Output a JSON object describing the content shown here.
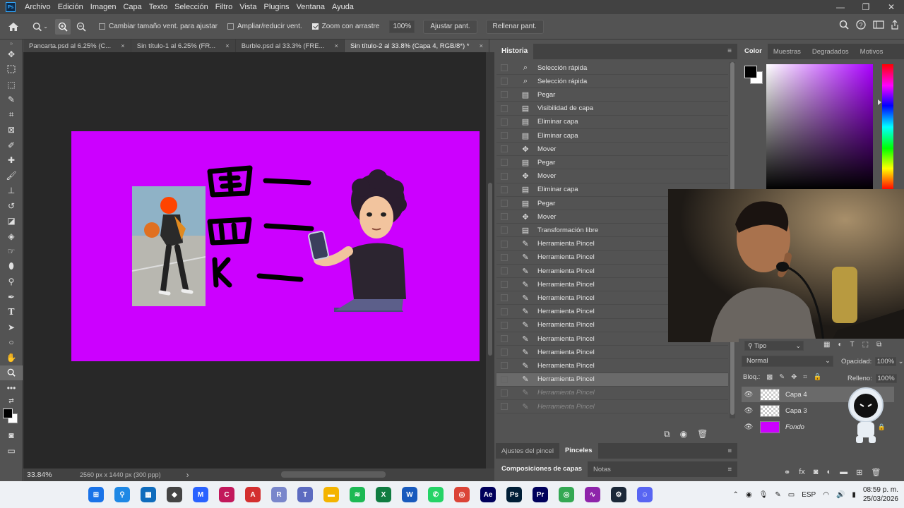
{
  "menu": {
    "app_icon_text": "Ps",
    "items": [
      "Archivo",
      "Edición",
      "Imagen",
      "Capa",
      "Texto",
      "Selección",
      "Filtro",
      "Vista",
      "Plugins",
      "Ventana",
      "Ayuda"
    ],
    "window_controls": [
      "—",
      "❐",
      "✕"
    ]
  },
  "options": {
    "home_icon": "home-icon",
    "zoom_icon": "zoom-icon",
    "resize_windows_label": "Cambiar tamaño vent. para ajustar",
    "resize_windows_checked": false,
    "zoom_all_label": "Ampliar/reducir vent.",
    "zoom_all_checked": false,
    "scrubby_label": "Zoom con arrastre",
    "scrubby_checked": true,
    "zoom_value": "100%",
    "fit_button": "Ajustar pant.",
    "fill_button": "Rellenar pant."
  },
  "doc_tabs": [
    {
      "label": "Pancarta.psd al 6.25% (C...",
      "close": "×",
      "active": false
    },
    {
      "label": "Sin título-1 al 6.25% (FR...",
      "close": "×",
      "active": false
    },
    {
      "label": "Burble.psd al 33.3% (FRE...",
      "close": "×",
      "active": false
    },
    {
      "label": "Sin título-2 al 33.8% (Capa 4, RGB/8*) *",
      "close": "×",
      "active": true
    }
  ],
  "status": {
    "zoom": "33.84%",
    "doc_info": "2560 px x 1440 px (300 ppp)",
    "arrow": "›"
  },
  "history": {
    "title": "Historia",
    "items": [
      {
        "icon": "quick-selection-icon",
        "label": "Selección rápida",
        "state": "normal"
      },
      {
        "icon": "quick-selection-icon",
        "label": "Selección rápida",
        "state": "normal"
      },
      {
        "icon": "document-icon",
        "label": "Pegar",
        "state": "normal"
      },
      {
        "icon": "document-icon",
        "label": "Visibilidad de capa",
        "state": "normal"
      },
      {
        "icon": "document-icon",
        "label": "Eliminar capa",
        "state": "normal"
      },
      {
        "icon": "document-icon",
        "label": "Eliminar capa",
        "state": "normal"
      },
      {
        "icon": "move-icon",
        "label": "Mover",
        "state": "normal"
      },
      {
        "icon": "document-icon",
        "label": "Pegar",
        "state": "normal"
      },
      {
        "icon": "move-icon",
        "label": "Mover",
        "state": "normal"
      },
      {
        "icon": "document-icon",
        "label": "Eliminar capa",
        "state": "normal"
      },
      {
        "icon": "document-icon",
        "label": "Pegar",
        "state": "normal"
      },
      {
        "icon": "move-icon",
        "label": "Mover",
        "state": "normal"
      },
      {
        "icon": "document-icon",
        "label": "Transformación libre",
        "state": "normal"
      },
      {
        "icon": "brush-icon",
        "label": "Herramienta Pincel",
        "state": "normal"
      },
      {
        "icon": "brush-icon",
        "label": "Herramienta Pincel",
        "state": "normal"
      },
      {
        "icon": "brush-icon",
        "label": "Herramienta Pincel",
        "state": "normal"
      },
      {
        "icon": "brush-icon",
        "label": "Herramienta Pincel",
        "state": "normal"
      },
      {
        "icon": "brush-icon",
        "label": "Herramienta Pincel",
        "state": "normal"
      },
      {
        "icon": "brush-icon",
        "label": "Herramienta Pincel",
        "state": "normal"
      },
      {
        "icon": "brush-icon",
        "label": "Herramienta Pincel",
        "state": "normal"
      },
      {
        "icon": "brush-icon",
        "label": "Herramienta Pincel",
        "state": "normal"
      },
      {
        "icon": "brush-icon",
        "label": "Herramienta Pincel",
        "state": "normal"
      },
      {
        "icon": "brush-icon",
        "label": "Herramienta Pincel",
        "state": "normal"
      },
      {
        "icon": "brush-icon",
        "label": "Herramienta Pincel",
        "state": "selected"
      },
      {
        "icon": "brush-icon",
        "label": "Herramienta Pincel",
        "state": "undone"
      },
      {
        "icon": "brush-icon",
        "label": "Herramienta Pincel",
        "state": "undone"
      }
    ]
  },
  "bottom_tabs_1": [
    "Ajustes del pincel",
    "Pinceles"
  ],
  "bottom_tabs_2": [
    "Composiciones de capas",
    "Notas"
  ],
  "color_panel": {
    "tabs": [
      "Color",
      "Muestras",
      "Degradados",
      "Motivos"
    ],
    "foreground": "#000000",
    "background": "#ffffff",
    "hue_color": "#aa00ff"
  },
  "layers": {
    "filter_label": "Tipo",
    "blend_mode": "Normal",
    "opacity_label": "Opacidad:",
    "opacity_value": "100%",
    "lock_label": "Bloq.:",
    "fill_label": "Relleno:",
    "fill_value": "100%",
    "items": [
      {
        "name": "Capa 4",
        "selected": true,
        "italic": false
      },
      {
        "name": "Capa 3",
        "selected": false,
        "italic": false
      },
      {
        "name": "Fondo",
        "selected": false,
        "italic": true
      }
    ]
  },
  "canvas": {
    "background": "#cc00ff",
    "handwriting": [
      "囧 —",
      "四 —",
      "K —"
    ]
  },
  "taskbar": {
    "language": "ESP",
    "time": "08:59 p. m.",
    "date": "25/03/2026",
    "apps": [
      {
        "name": "windows-start-icon",
        "color": "#1a73e8"
      },
      {
        "name": "search-icon",
        "color": "#1e88e5"
      },
      {
        "name": "calculator-icon",
        "color": "#0f6cbd"
      },
      {
        "name": "app-cube-icon",
        "color": "#444444"
      },
      {
        "name": "app-blue-icon",
        "color": "#2962ff"
      },
      {
        "name": "adobe-c-icon",
        "color": "#c2185b"
      },
      {
        "name": "autocad-icon",
        "color": "#d32f2f"
      },
      {
        "name": "app-r-icon",
        "color": "#7986cb"
      },
      {
        "name": "teams-icon",
        "color": "#5c6bc0"
      },
      {
        "name": "file-explorer-icon",
        "color": "#f4b400"
      },
      {
        "name": "spotify-icon",
        "color": "#1db954"
      },
      {
        "name": "excel-icon",
        "color": "#107c41"
      },
      {
        "name": "word-icon",
        "color": "#185abd"
      },
      {
        "name": "whatsapp-icon",
        "color": "#25d366"
      },
      {
        "name": "chrome-icon",
        "color": "#db4437"
      },
      {
        "name": "after-effects-icon",
        "color": "#00005b"
      },
      {
        "name": "photoshop-icon",
        "color": "#001e36"
      },
      {
        "name": "premiere-icon",
        "color": "#00005b"
      },
      {
        "name": "chrome-profile-icon",
        "color": "#34a853"
      },
      {
        "name": "app-wave-icon",
        "color": "#8e24aa"
      },
      {
        "name": "steam-icon",
        "color": "#1b2838"
      },
      {
        "name": "discord-icon",
        "color": "#5865f2"
      }
    ]
  }
}
